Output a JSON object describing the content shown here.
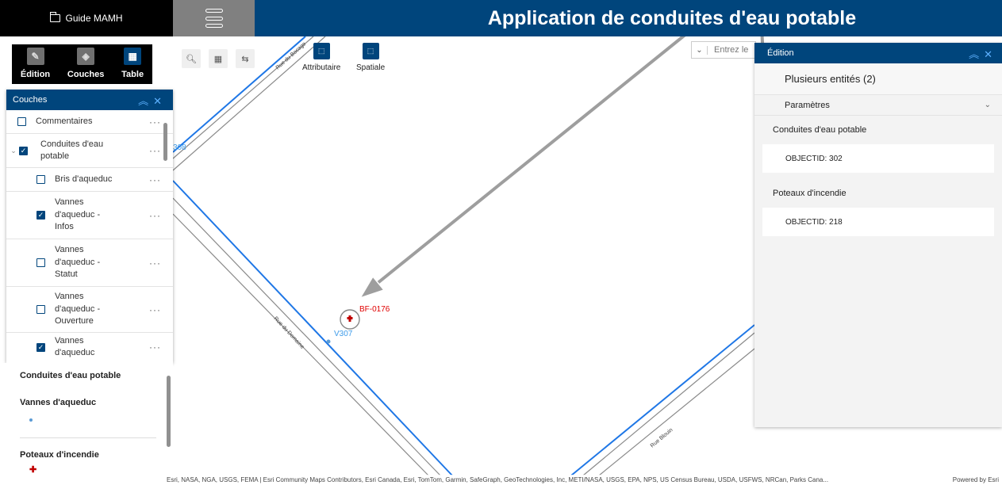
{
  "header": {
    "guide_label": "Guide MAMH",
    "app_title": "Application de conduites d'eau potable"
  },
  "toolbar": {
    "items": [
      {
        "label": "Édition",
        "icon": "edit-icon"
      },
      {
        "label": "Couches",
        "icon": "layers-icon"
      },
      {
        "label": "Table",
        "icon": "table-icon"
      }
    ]
  },
  "couches": {
    "title": "Couches",
    "layers": [
      {
        "label": "Commentaires",
        "checked": false
      },
      {
        "label": "Conduites d'eau potable",
        "checked": true
      },
      {
        "label": "Bris d'aqueduc",
        "checked": false
      },
      {
        "label": "Vannes d'aqueduc - Infos",
        "checked": true
      },
      {
        "label": "Vannes d'aqueduc - Statut",
        "checked": false
      },
      {
        "label": "Vannes d'aqueduc - Ouverture",
        "checked": false
      },
      {
        "label": "Vannes d'aqueduc",
        "checked": true
      }
    ],
    "more_label": "···"
  },
  "legend": {
    "title": "Conduites d'eau potable",
    "sections": [
      {
        "label": "Vannes d'aqueduc",
        "symbol": "dot"
      },
      {
        "label": "Poteaux d'incendie",
        "symbol": "cross"
      }
    ]
  },
  "selection": {
    "attributaire": "Attributaire",
    "spatiale": "Spatiale"
  },
  "search": {
    "placeholder": "Entrez le"
  },
  "edition": {
    "title": "Édition",
    "subtitle": "Plusieurs entités (2)",
    "params_label": "Paramètres",
    "groups": [
      {
        "label": "Conduites d'eau potable",
        "item": "OBJECTID: 302"
      },
      {
        "label": "Poteaux d'incendie",
        "item": "OBJECTID: 218"
      }
    ]
  },
  "map": {
    "streets": [
      "Rue du Bocage",
      "Rue du Domaine",
      "Rue Blouin"
    ],
    "hydrant_label": "BF-0176",
    "valve_label": "V307",
    "valve_label_partial": "308"
  },
  "attribution": {
    "text": "Esri, NASA, NGA, USGS, FEMA | Esri Community Maps Contributors, Esri Canada, Esri, TomTom, Garmin, SafeGraph, GeoTechnologies, Inc, METI/NASA, USGS, EPA, NPS, US Census Bureau, USDA, USFWS, NRCan, Parks Cana...",
    "powered": "Powered by Esri"
  },
  "colors": {
    "primary": "#00457c",
    "pipe": "#1f77e6",
    "hydrant": "#c00000",
    "arrow": "#9e9e9e"
  }
}
